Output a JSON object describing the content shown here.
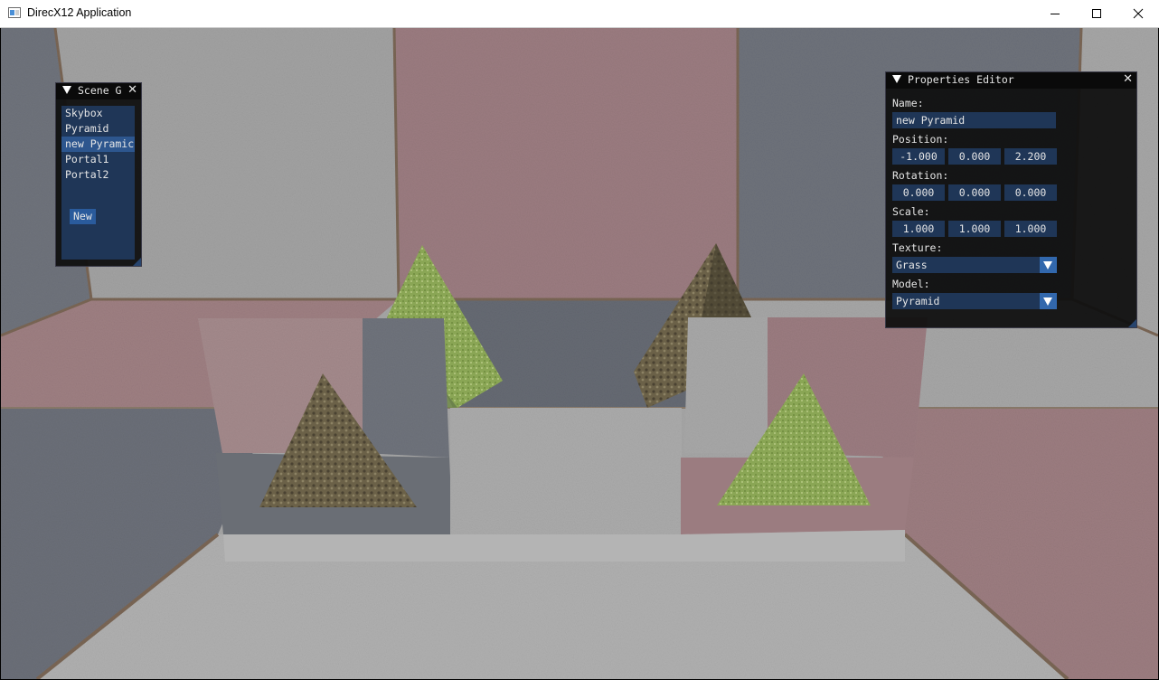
{
  "window": {
    "title": "DirecX12 Application"
  },
  "scene_graph": {
    "title": "Scene G",
    "items": [
      {
        "label": "Skybox"
      },
      {
        "label": "Pyramid"
      },
      {
        "label": "new Pyramic"
      },
      {
        "label": "Portal1"
      },
      {
        "label": "Portal2"
      }
    ],
    "selected_index": 2,
    "new_button": "New"
  },
  "properties": {
    "title": "Properties Editor",
    "name_label": "Name:",
    "name_value": "new Pyramid",
    "position_label": "Position:",
    "position": [
      "-1.000",
      "0.000",
      "2.200"
    ],
    "rotation_label": "Rotation:",
    "rotation": [
      "0.000",
      "0.000",
      "0.000"
    ],
    "scale_label": "Scale:",
    "scale": [
      "1.000",
      "1.000",
      "1.000"
    ],
    "texture_label": "Texture:",
    "texture_value": "Grass",
    "model_label": "Model:",
    "model_value": "Pyramid"
  },
  "colors": {
    "imgui_frame": "#1f3657",
    "imgui_button": "#2a5b9c",
    "imgui_selected": "#2d568e",
    "grass": "#8aa655",
    "sand": "#6b6148",
    "concrete": "#a7a7a7",
    "red_brick": "#9c7d80",
    "blue_stone": "#6f737c"
  }
}
